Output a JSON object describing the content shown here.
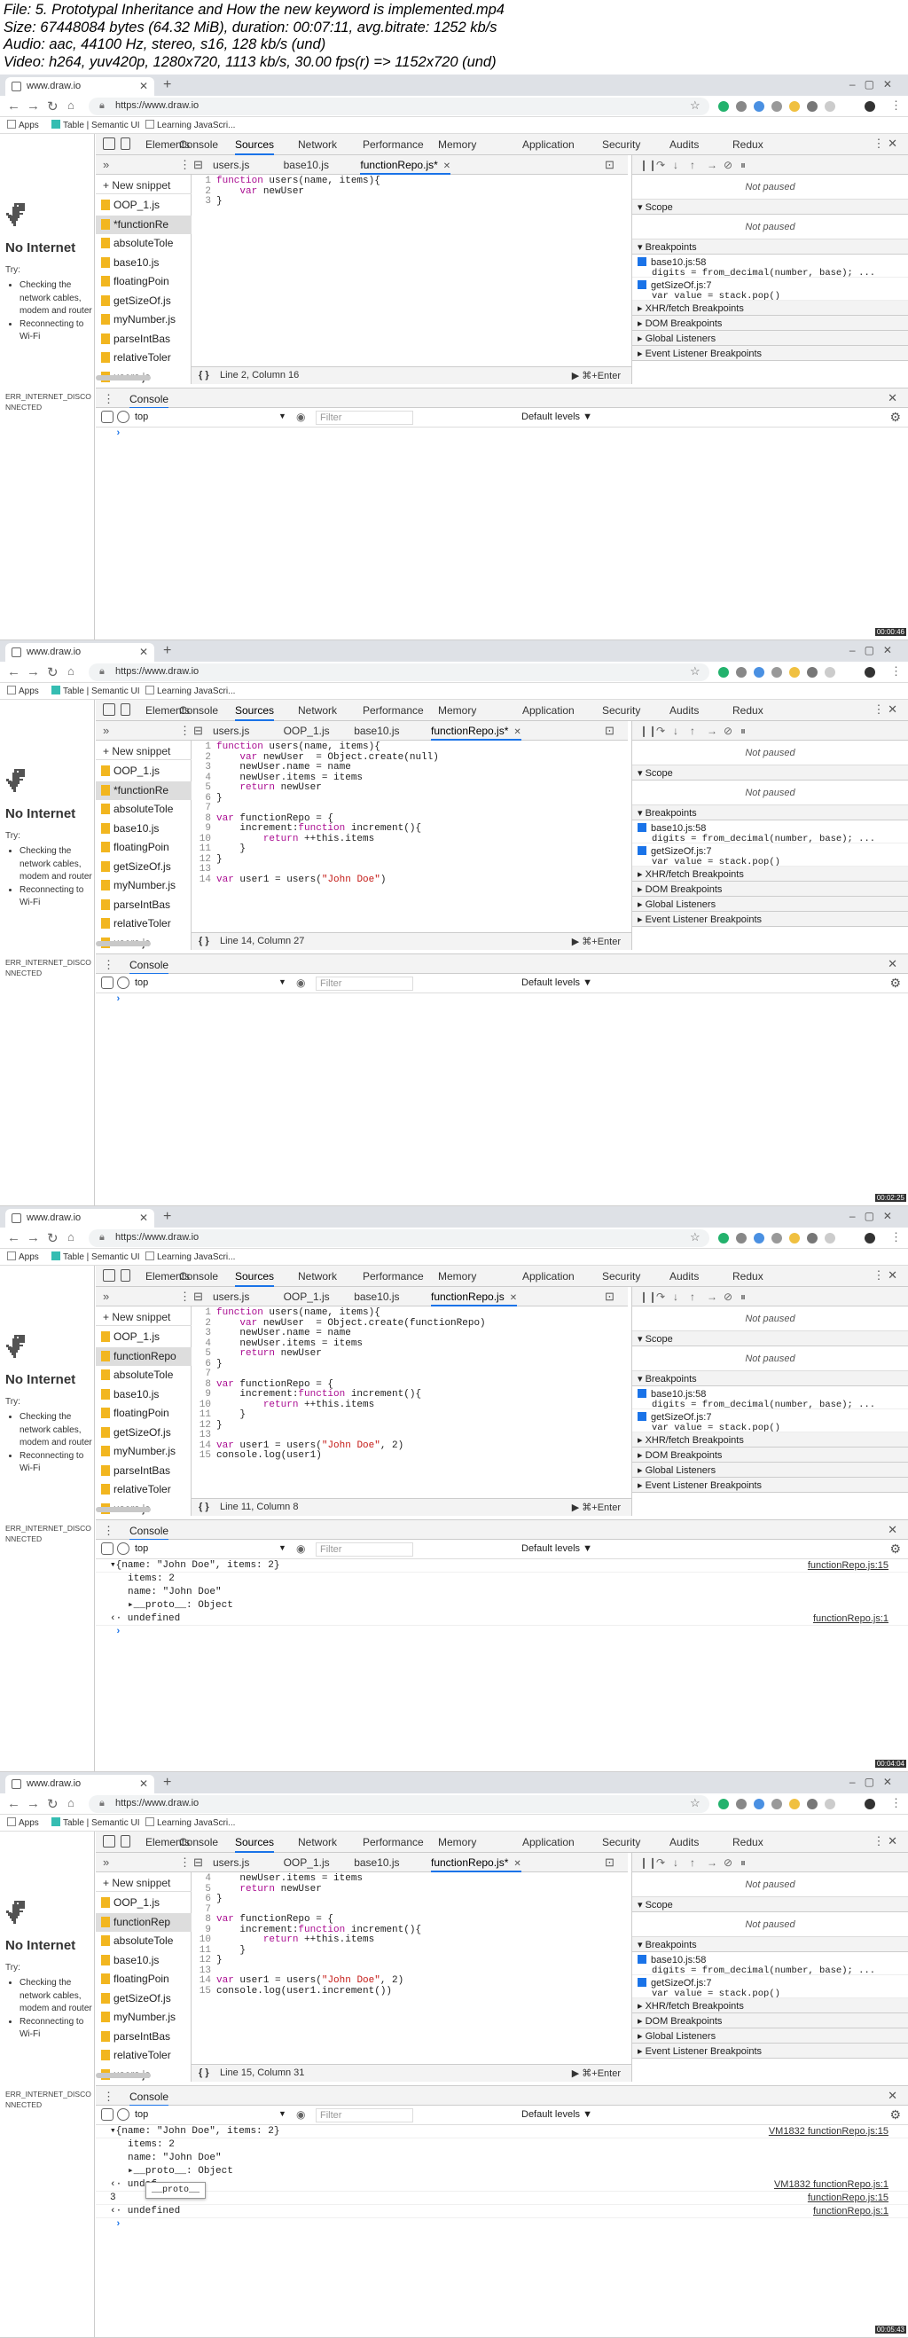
{
  "file_info": [
    "File: 5. Prototypal Inheritance and How the new keyword is implemented.mp4",
    "Size: 67448084 bytes (64.32 MiB), duration: 00:07:11, avg.bitrate: 1252 kb/s",
    "Audio: aac, 44100 Hz, stereo, s16, 128 kb/s (und)",
    "Video: h264, yuv420p, 1280x720, 1113 kb/s, 30.00 fps(r) => 1152x720 (und)"
  ],
  "browser": {
    "tab_title": "www.draw.io",
    "url": "https://www.draw.io",
    "bookmarks": [
      "Apps",
      "Table | Semantic UI",
      "Learning JavaScri..."
    ]
  },
  "page": {
    "heading": "No Internet",
    "try_label": "Try:",
    "suggestions": [
      "Checking the network cables, modem and router",
      "Reconnecting to Wi-Fi"
    ],
    "error_code": "ERR_INTERNET_DISCONNECTED"
  },
  "devtools": {
    "main_tabs": [
      "Elements",
      "Console",
      "Sources",
      "Network",
      "Performance",
      "Memory",
      "Application",
      "Security",
      "Audits",
      "Redux"
    ],
    "active_tab": "Sources",
    "new_snippet": "+ New snippet",
    "not_paused": "Not paused",
    "scope": "Scope",
    "breakpoints_title": "Breakpoints",
    "breakpoints": [
      {
        "file": "base10.js:58",
        "code": "digits = from_decimal(number, base); ..."
      },
      {
        "file": "getSizeOf.js:7",
        "code": "var value = stack.pop()"
      }
    ],
    "sections": [
      "XHR/fetch Breakpoints",
      "DOM Breakpoints",
      "Global Listeners",
      "Event Listener Breakpoints"
    ],
    "console_title": "Console",
    "context": "top",
    "filter_placeholder": "Filter",
    "levels": "Default levels ▼",
    "run_hint": "▶ ⌘+Enter",
    "braces": "{ }"
  },
  "frames": [
    {
      "file_tabs": [
        "users.js",
        "base10.js",
        "functionRepo.js*"
      ],
      "active_file": "functionRepo.js*",
      "files": [
        "OOP_1.js",
        "*functionRe",
        "absoluteTole",
        "base10.js",
        "floatingPoin",
        "getSizeOf.js",
        "myNumber.js",
        "parseIntBas",
        "relativeToler",
        "users.js"
      ],
      "selected_file": 1,
      "line_numbers": [
        "1",
        "2",
        "3"
      ],
      "code_lines": [
        "function users(name, items){",
        "    var newUser",
        "}"
      ],
      "cursor_pos": "Line 2, Column 16",
      "console_lines": [],
      "stamp": "00:00:46"
    },
    {
      "file_tabs": [
        "users.js",
        "OOP_1.js",
        "base10.js",
        "functionRepo.js*"
      ],
      "active_file": "functionRepo.js*",
      "files": [
        "OOP_1.js",
        "*functionRe",
        "absoluteTole",
        "base10.js",
        "floatingPoin",
        "getSizeOf.js",
        "myNumber.js",
        "parseIntBas",
        "relativeToler",
        "users.js"
      ],
      "selected_file": 1,
      "line_numbers": [
        "1",
        "2",
        "3",
        "4",
        "5",
        "6",
        "7",
        "8",
        "9",
        "10",
        "11",
        "12",
        "13",
        "14"
      ],
      "code_lines": [
        "function users(name, items){",
        "    var newUser  = Object.create(null)",
        "    newUser.name = name",
        "    newUser.items = items",
        "    return newUser",
        "}",
        "",
        "var functionRepo = {",
        "    increment:function increment(){",
        "        return ++this.items",
        "    }",
        "}",
        "",
        "var user1 = users(\"John Doe\")"
      ],
      "cursor_pos": "Line 14, Column 27",
      "console_lines": [],
      "stamp": "00:02:25"
    },
    {
      "file_tabs": [
        "users.js",
        "OOP_1.js",
        "base10.js",
        "functionRepo.js"
      ],
      "active_file": "functionRepo.js",
      "files": [
        "OOP_1.js",
        "functionRepo",
        "absoluteTole",
        "base10.js",
        "floatingPoin",
        "getSizeOf.js",
        "myNumber.js",
        "parseIntBas",
        "relativeToler",
        "users.js"
      ],
      "selected_file": 1,
      "line_numbers": [
        "1",
        "2",
        "3",
        "4",
        "5",
        "6",
        "7",
        "8",
        "9",
        "10",
        "11",
        "12",
        "13",
        "14",
        "15"
      ],
      "code_lines": [
        "function users(name, items){",
        "    var newUser  = Object.create(functionRepo)",
        "    newUser.name = name",
        "    newUser.items = items",
        "    return newUser",
        "}",
        "",
        "var functionRepo = {",
        "    increment:function increment(){",
        "        return ++this.items",
        "    }",
        "}",
        "",
        "var user1 = users(\"John Doe\", 2)",
        "console.log(user1)"
      ],
      "cursor_pos": "Line 11, Column 8",
      "console_lines": [
        {
          "text": "▾{name: \"John Doe\", items: 2}",
          "src": "functionRepo.js:15",
          "indent": 0
        },
        {
          "text": "items: 2",
          "src": "",
          "indent": 2
        },
        {
          "text": "name: \"John Doe\"",
          "src": "",
          "indent": 2
        },
        {
          "text": "▸__proto__: Object",
          "src": "",
          "indent": 2
        },
        {
          "text": "‹· undefined",
          "src": "functionRepo.js:1",
          "indent": 0
        }
      ],
      "stamp": "00:04:04"
    },
    {
      "file_tabs": [
        "users.js",
        "OOP_1.js",
        "base10.js",
        "functionRepo.js*"
      ],
      "active_file": "functionRepo.js*",
      "files": [
        "OOP_1.js",
        "functionRep",
        "absoluteTole",
        "base10.js",
        "floatingPoin",
        "getSizeOf.js",
        "myNumber.js",
        "parseIntBas",
        "relativeToler",
        "users.js"
      ],
      "selected_file": 1,
      "line_numbers": [
        "4",
        "5",
        "6",
        "7",
        "8",
        "9",
        "10",
        "11",
        "12",
        "13",
        "14",
        "15"
      ],
      "code_lines": [
        "    newUser.items = items",
        "    return newUser",
        "}",
        "",
        "var functionRepo = {",
        "    increment:function increment(){",
        "        return ++this.items",
        "    }",
        "}",
        "",
        "var user1 = users(\"John Doe\", 2)",
        "console.log(user1.increment())"
      ],
      "cursor_pos": "Line 15, Column 31",
      "console_lines": [
        {
          "text": "▾{name: \"John Doe\", items: 2}",
          "src": "VM1832 functionRepo.js:15",
          "indent": 0
        },
        {
          "text": "items: 2",
          "src": "",
          "indent": 2
        },
        {
          "text": "name: \"John Doe\"",
          "src": "",
          "indent": 2
        },
        {
          "text": "▸__proto__: Object",
          "src": "",
          "indent": 2
        },
        {
          "text": "‹· undef",
          "src": "VM1832 functionRepo.js:1",
          "indent": 0
        },
        {
          "text": "3",
          "src": "functionRepo.js:15",
          "indent": 0
        },
        {
          "text": "‹· undefined",
          "src": "functionRepo.js:1",
          "indent": 0
        }
      ],
      "tooltip": "__proto__",
      "stamp": "00:05:43"
    }
  ]
}
